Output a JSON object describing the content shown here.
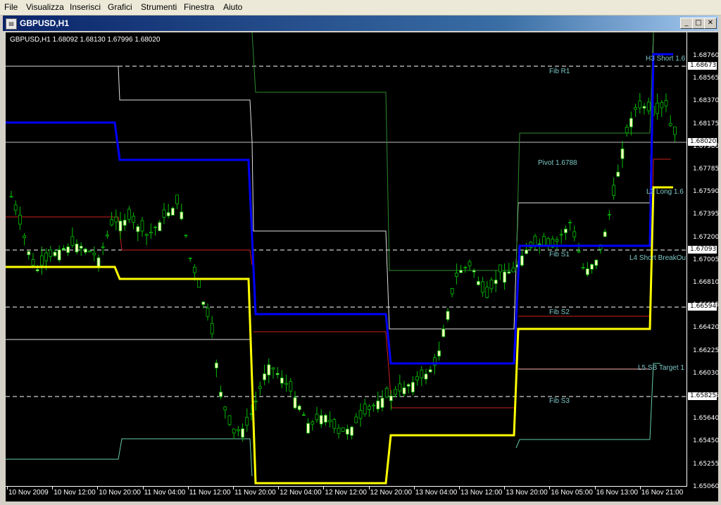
{
  "menu": [
    "File",
    "Visualizza",
    "Inserisci",
    "Grafici",
    "Strumenti",
    "Finestra",
    "Aiuto"
  ],
  "window": {
    "title": "GBPUSD,H1",
    "icon": "chart-window-icon"
  },
  "chart": {
    "info": "GBPUSD,H1  1.68092 1.68130 1.67996 1.68020",
    "price_labels": [
      "1.68760",
      "1.68565",
      "1.68370",
      "1.68175",
      "1.67980",
      "1.67785",
      "1.67590",
      "1.67395",
      "1.67200",
      "1.67005",
      "1.66810",
      "1.66615",
      "1.66420",
      "1.66225",
      "1.66030",
      "1.65835",
      "1.65640",
      "1.65450",
      "1.65255",
      "1.65060"
    ],
    "price_boxes": [
      "1.68673",
      "1.68020",
      "1.67093",
      "1.66594",
      "1.65825"
    ],
    "time_labels": [
      "10 Nov 2009",
      "10 Nov 12:00",
      "10 Nov 20:00",
      "11 Nov 04:00",
      "11 Nov 12:00",
      "11 Nov 20:00",
      "12 Nov 04:00",
      "12 Nov 12:00",
      "12 Nov 20:00",
      "13 Nov 04:00",
      "13 Nov 12:00",
      "13 Nov 20:00",
      "16 Nov 05:00",
      "16 Nov 13:00",
      "16 Nov 21:00"
    ],
    "annotations": {
      "fib_r1": "Fib R1",
      "pivot": "Pivot  1.6788",
      "h3": "H3 Short 1.6",
      "l3": "L3 Long 1.6",
      "fib_s1": "Fib S1",
      "l4": "L4 Short BreakOu",
      "fib_s2": "Fib S2",
      "l5": "L5 SB Target 1",
      "fib_s3": "Fib S3"
    },
    "colors": {
      "blue_line": "#0000ff",
      "yellow_line": "#ffff00",
      "bull_candle": "#ffffc0",
      "wick": "#00c000"
    }
  }
}
